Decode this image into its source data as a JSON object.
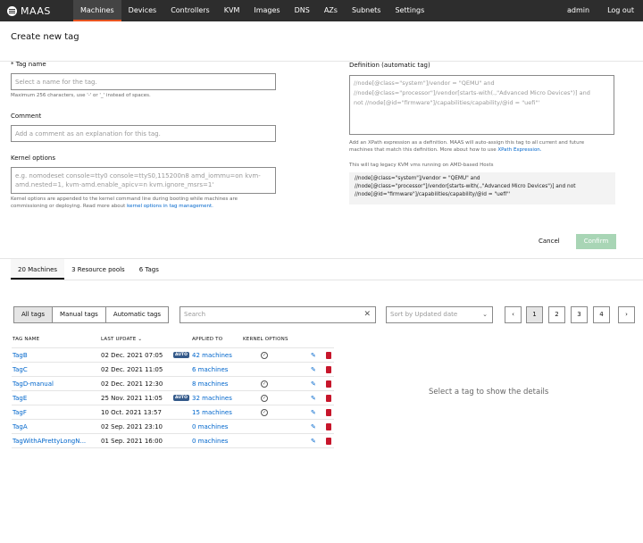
{
  "nav": {
    "brand": "MAAS",
    "items": [
      "Machines",
      "Devices",
      "Controllers",
      "KVM",
      "Images",
      "DNS",
      "AZs",
      "Subnets",
      "Settings"
    ],
    "user": "admin",
    "logout": "Log out"
  },
  "page": {
    "title": "Create new tag"
  },
  "form": {
    "tag_name_label": "* Tag name",
    "tag_name_placeholder": "Select a name for the tag.",
    "tag_name_hint": "Maximum 256 characters, use '-' or '_' instead of spaces.",
    "comment_label": "Comment",
    "comment_placeholder": "Add a comment as an explanation for this tag.",
    "kernel_label": "Kernel options",
    "kernel_placeholder_1": "e.g. nomodeset console=tty0 console=ttyS0,115200n8 amd_iommu=on  kvm-",
    "kernel_placeholder_2": "amd.nested=1, kvm-amd.enable_apicv=n  kvm.ignore_msrs=1'",
    "kernel_hint_1": "Kernel options are appended to the kernel command line during booting while machines are",
    "kernel_hint_2": "commissioning or deploying. Read more about ",
    "kernel_hint_link": "kernel options in tag management.",
    "definition_label": "Definition (automatic tag)",
    "definition_placeholder": [
      "//node[@class=\"system\"]/vendor = \"QEMU\" and",
      "//node[@class=\"processor\"]/vendor[starts-with(.,\"Advanced Micro Devices\")] and",
      "not //node[@id=\"firmware\"]/capabilities/capability/@id = \"uefi\"'"
    ],
    "definition_hint_1": "Add an XPath expression as a definition. MAAS will auto-assign this tag to  all current and future",
    "definition_hint_2": "machines that match this definition. More about how to use ",
    "definition_hint_link": "XPath Expression.",
    "example_caption": "This will tag legacy KVM vms running on AMD-based Hosts",
    "example_code": [
      "//node[@class=\"system\"]/vendor = \"QEMU\" and",
      "//node[@class=\"processor\"]/vendor[starts-with(.,\"Advanced Micro Devices\")] and not",
      "//node[@id=\"firmware\"]/capabilities/capability/@id = \"uefi\"'"
    ],
    "cancel": "Cancel",
    "confirm": "Confirm"
  },
  "tabs": [
    "20 Machines",
    "3 Resource pools",
    "6 Tags"
  ],
  "filters": {
    "segments": [
      "All tags",
      "Manual tags",
      "Automatic tags"
    ],
    "search_placeholder": "Search",
    "sort_placeholder": "Sort by Updated date",
    "pages": [
      "1",
      "2",
      "3",
      "4"
    ]
  },
  "table": {
    "headers": [
      "TAG NAME",
      "LAST UPDATE",
      "APPLIED TO",
      "KERNEL OPTIONS"
    ],
    "rows": [
      {
        "name": "TagB",
        "updated": "02 Dec. 2021 07:05",
        "auto": true,
        "applied": "42 machines",
        "kernel": true
      },
      {
        "name": "TagC",
        "updated": "02 Dec. 2021 11:05",
        "auto": false,
        "applied": "6 machines",
        "kernel": false
      },
      {
        "name": "TagD-manual",
        "updated": "02 Dec. 2021 12:30",
        "auto": false,
        "applied": "8 machines",
        "kernel": true
      },
      {
        "name": "TagE",
        "updated": "25 Nov. 2021 11:05",
        "auto": true,
        "applied": "32 machines",
        "kernel": true
      },
      {
        "name": "TagF",
        "updated": "10 Oct. 2021 13:57",
        "auto": false,
        "applied": "15 machines",
        "kernel": true
      },
      {
        "name": "TagA",
        "updated": "02 Sep. 2021 23:10",
        "auto": false,
        "applied": "0 machines",
        "kernel": false
      },
      {
        "name": "TagWithAPrettyLongN...",
        "updated": "01 Sep. 2021 16:00",
        "auto": false,
        "applied": "0 machines",
        "kernel": false
      }
    ],
    "auto_badge": "AUTO"
  },
  "details_empty": "Select a tag to show the details",
  "colors": {
    "nav_bg": "#2d2d2d",
    "accent": "#e95420",
    "link": "#0066cc",
    "confirm_disabled": "#a8d5b5",
    "auto_badge": "#345a8a",
    "delete": "#c7162b"
  }
}
